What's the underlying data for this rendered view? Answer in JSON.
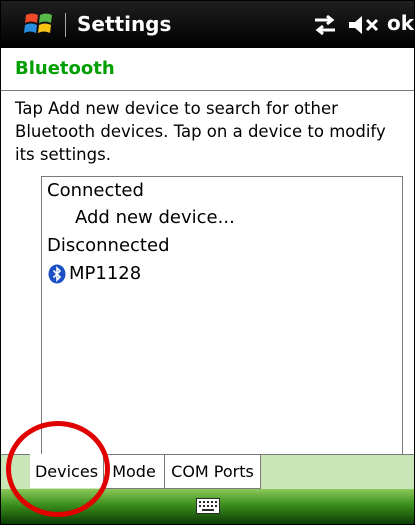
{
  "titlebar": {
    "title": "Settings",
    "ok_label": "ok",
    "icons": [
      "windows-start-icon",
      "connectivity-icon",
      "volume-muted-icon"
    ]
  },
  "heading": "Bluetooth",
  "instructions": "Tap Add new device to search for other Bluetooth devices. Tap on a device to modify its settings.",
  "device_list": {
    "connected_header": "Connected",
    "add_new": "Add new device...",
    "disconnected_header": "Disconnected",
    "devices": [
      {
        "name": "MP1128",
        "icon": "bluetooth-icon"
      }
    ]
  },
  "tabs": [
    {
      "label": "Devices",
      "active": true
    },
    {
      "label": "Mode",
      "active": false
    },
    {
      "label": "COM Ports",
      "active": false
    }
  ],
  "bottombar": {
    "icon": "keyboard-icon"
  },
  "colors": {
    "heading": "#00a000",
    "tabbar": "#c9e6b8",
    "annotation": "#e00000"
  }
}
